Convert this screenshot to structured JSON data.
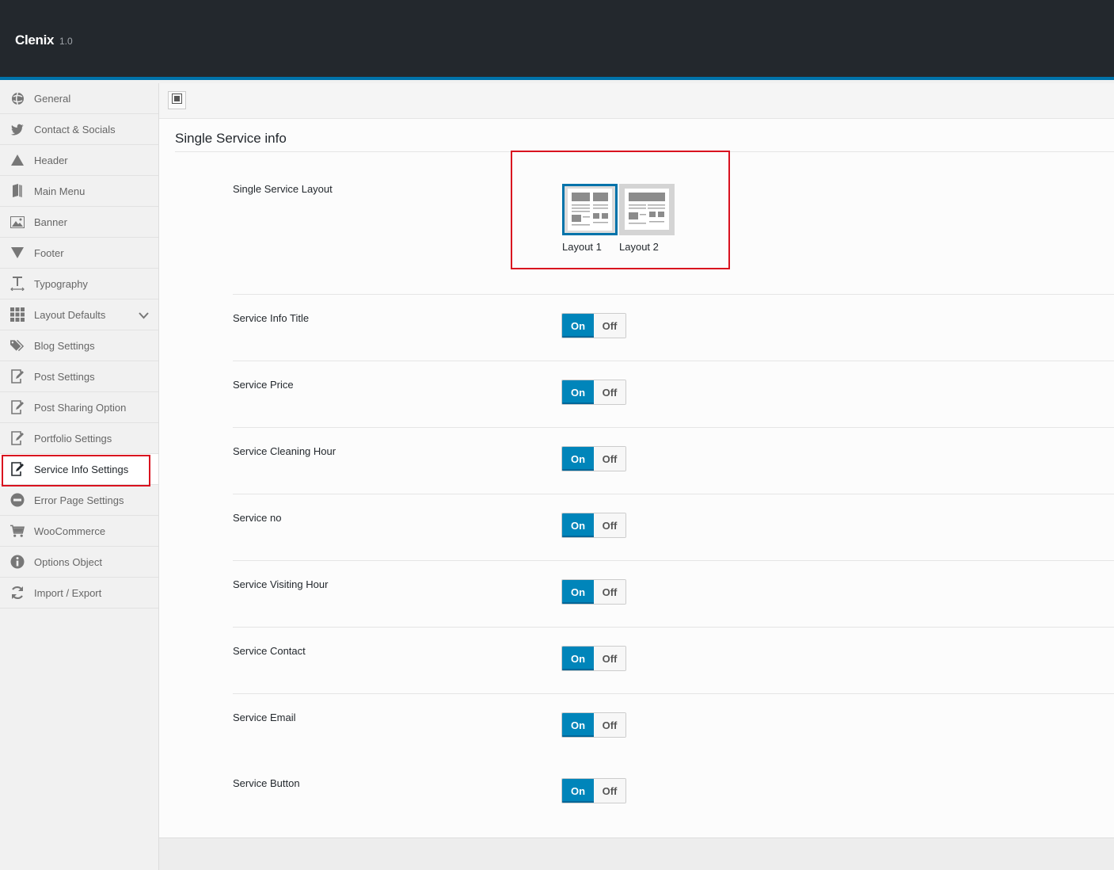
{
  "app": {
    "title": "Clenix",
    "version": "1.0"
  },
  "sidebar": {
    "items": [
      {
        "label": "General",
        "icon": "globe-icon"
      },
      {
        "label": "Contact & Socials",
        "icon": "twitter-icon"
      },
      {
        "label": "Header",
        "icon": "triangle-up-icon"
      },
      {
        "label": "Main Menu",
        "icon": "book-icon"
      },
      {
        "label": "Banner",
        "icon": "image-icon"
      },
      {
        "label": "Footer",
        "icon": "triangle-down-icon"
      },
      {
        "label": "Typography",
        "icon": "text-icon"
      },
      {
        "label": "Layout Defaults",
        "icon": "grid-icon"
      },
      {
        "label": "Blog Settings",
        "icon": "tags-icon"
      },
      {
        "label": "Post Settings",
        "icon": "edit-icon"
      },
      {
        "label": "Post Sharing Option",
        "icon": "edit-icon"
      },
      {
        "label": "Portfolio Settings",
        "icon": "edit-icon"
      },
      {
        "label": "Service Info Settings",
        "icon": "edit-icon",
        "active": true
      },
      {
        "label": "Error Page Settings",
        "icon": "minus-circle-icon"
      },
      {
        "label": "WooCommerce",
        "icon": "cart-icon"
      },
      {
        "label": "Options Object",
        "icon": "info-icon"
      },
      {
        "label": "Import / Export",
        "icon": "refresh-icon"
      }
    ]
  },
  "main": {
    "section_title": "Single Service info",
    "layout_field": {
      "label": "Single Service Layout",
      "options": [
        {
          "caption": "Layout 1",
          "selected": true
        },
        {
          "caption": "Layout 2",
          "selected": false
        }
      ]
    },
    "switches": [
      {
        "label": "Service Info Title",
        "on": "On",
        "off": "Off",
        "value": "On"
      },
      {
        "label": "Service Price",
        "on": "On",
        "off": "Off",
        "value": "On"
      },
      {
        "label": "Service Cleaning Hour",
        "on": "On",
        "off": "Off",
        "value": "On"
      },
      {
        "label": "Service no",
        "on": "On",
        "off": "Off",
        "value": "On"
      },
      {
        "label": "Service Visiting Hour",
        "on": "On",
        "off": "Off",
        "value": "On"
      },
      {
        "label": "Service Contact",
        "on": "On",
        "off": "Off",
        "value": "On"
      },
      {
        "label": "Service Email",
        "on": "On",
        "off": "Off",
        "value": "On"
      },
      {
        "label": "Service Button",
        "on": "On",
        "off": "Off",
        "value": "On"
      }
    ]
  },
  "colors": {
    "accent": "#0085ba",
    "highlight": "#d9121f",
    "topbar": "#23282d"
  }
}
